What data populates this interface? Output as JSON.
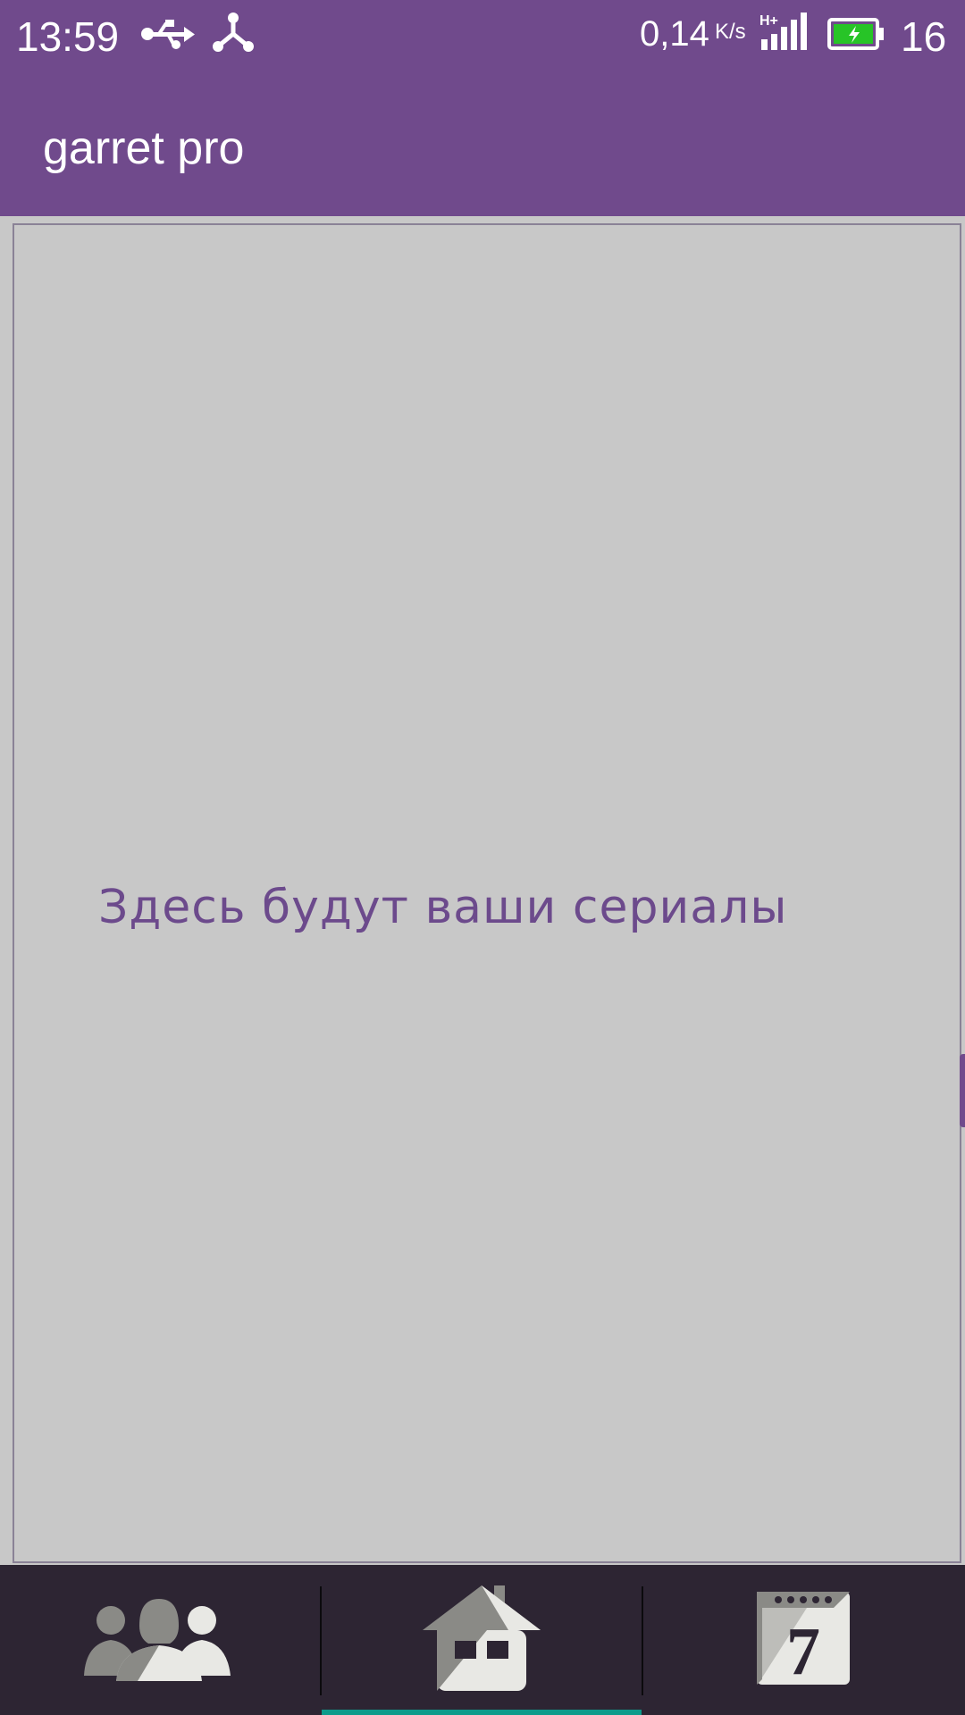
{
  "status_bar": {
    "time": "13:59",
    "speed_value": "0,14",
    "speed_unit": "K/s",
    "network_type": "H+",
    "battery_level": "16",
    "icons": [
      "usb-icon",
      "share-icon",
      "signal-icon",
      "battery-charging-icon"
    ]
  },
  "app_bar": {
    "title": "garret pro"
  },
  "content": {
    "empty_message": "Здесь будут ваши сериалы"
  },
  "bottom_nav": {
    "tabs": [
      {
        "icon": "people-icon",
        "selected": false
      },
      {
        "icon": "home-icon",
        "selected": true
      },
      {
        "icon": "calendar-icon",
        "selected": false,
        "calendar_number": "7"
      }
    ]
  },
  "colors": {
    "primary": "#704a8c",
    "background": "#c8c8c8",
    "nav_background": "#2d2533",
    "accent": "#0d9b8b",
    "message_text": "#6c4a8c"
  }
}
